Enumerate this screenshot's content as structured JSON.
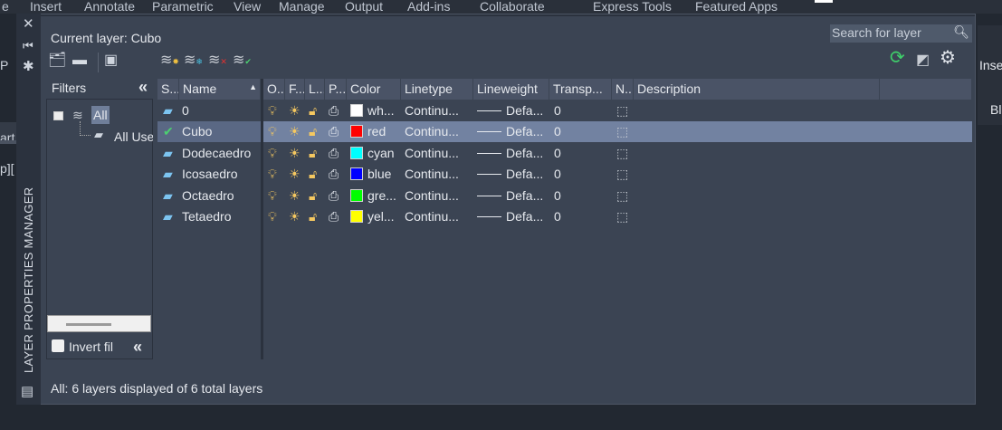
{
  "ribbon_tabs": [
    "e",
    "Insert",
    "Annotate",
    "Parametric",
    "View",
    "Manage",
    "Output",
    "Add-ins",
    "Collaborate",
    "Express Tools",
    "Featured Apps"
  ],
  "background_fragments": {
    "left1": "P",
    "left2": "art",
    "left3": "p][",
    "right1": "Inse",
    "right2": "Bl"
  },
  "palette": {
    "title": "LAYER PROPERTIES MANAGER",
    "current_layer": "Current layer: Cubo",
    "search_placeholder": "Search for layer",
    "status": "All: 6 layers displayed of 6 total layers"
  },
  "filters": {
    "title": "Filters",
    "collapse": "«",
    "tree": [
      {
        "label": "All"
      },
      {
        "label": "All Used Layers"
      }
    ],
    "invert_label": "Invert fil"
  },
  "columns": [
    "S...",
    "Name",
    "O...",
    "F...",
    "L...",
    "P...",
    "Color",
    "Linetype",
    "Lineweight",
    "Transp...",
    "N..",
    "Description"
  ],
  "layers": [
    {
      "name": "0",
      "color_name": "wh...",
      "color": "#ffffff",
      "linetype": "Continu...",
      "lineweight": "Defa...",
      "transparency": "0",
      "current": false
    },
    {
      "name": "Cubo",
      "color_name": "red",
      "color": "#ff0000",
      "linetype": "Continu...",
      "lineweight": "Defa...",
      "transparency": "0",
      "current": true
    },
    {
      "name": "Dodecaedro",
      "color_name": "cyan",
      "color": "#00ffff",
      "linetype": "Continu...",
      "lineweight": "Defa...",
      "transparency": "0",
      "current": false
    },
    {
      "name": "Icosaedro",
      "color_name": "blue",
      "color": "#0000ff",
      "linetype": "Continu...",
      "lineweight": "Defa...",
      "transparency": "0",
      "current": false
    },
    {
      "name": "Octaedro",
      "color_name": "gre...",
      "color": "#00ff00",
      "linetype": "Continu...",
      "lineweight": "Defa...",
      "transparency": "0",
      "current": false
    },
    {
      "name": "Tetaedro",
      "color_name": "yel...",
      "color": "#ffff00",
      "linetype": "Continu...",
      "lineweight": "Defa...",
      "transparency": "0",
      "current": false
    }
  ]
}
